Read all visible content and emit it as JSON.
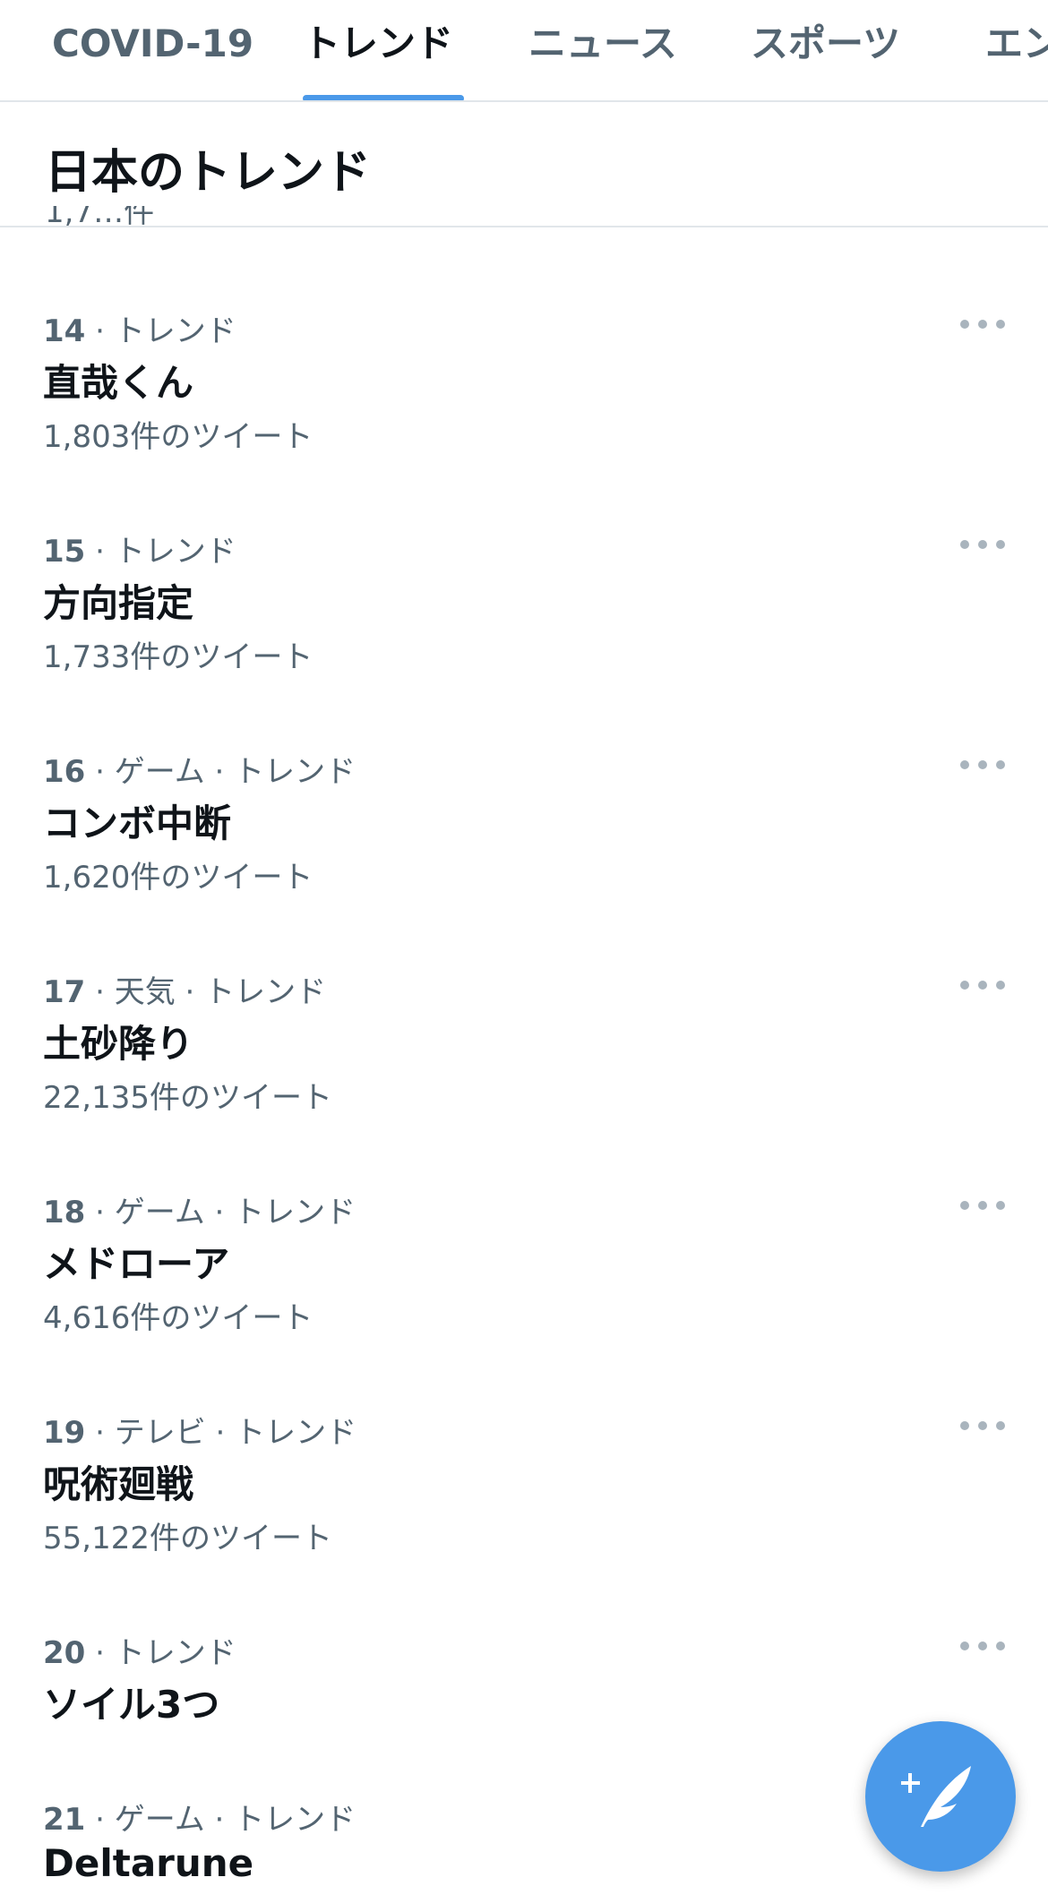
{
  "tabs": [
    {
      "label": "COVID-19",
      "active": false
    },
    {
      "label": "トレンド",
      "active": true
    },
    {
      "label": "ニュース",
      "active": false
    },
    {
      "label": "スポーツ",
      "active": false
    },
    {
      "label": "エンタメ",
      "active": false
    }
  ],
  "section": {
    "title": "日本のトレンド",
    "clipped_text": "1,7…件"
  },
  "trends": [
    {
      "rank": "14",
      "context": " · トレンド",
      "name": "直哉くん",
      "count": "1,803件のツイート"
    },
    {
      "rank": "15",
      "context": " · トレンド",
      "name": "方向指定",
      "count": "1,733件のツイート"
    },
    {
      "rank": "16",
      "context": " · ゲーム · トレンド",
      "name": "コンボ中断",
      "count": "1,620件のツイート"
    },
    {
      "rank": "17",
      "context": " · 天気 · トレンド",
      "name": "土砂降り",
      "count": "22,135件のツイート"
    },
    {
      "rank": "18",
      "context": " · ゲーム · トレンド",
      "name": "メドローア",
      "count": "4,616件のツイート"
    },
    {
      "rank": "19",
      "context": " · テレビ · トレンド",
      "name": "呪術廻戦",
      "count": "55,122件のツイート"
    },
    {
      "rank": "20",
      "context": " · トレンド",
      "name": "ソイル3つ",
      "count": ""
    },
    {
      "rank": "21",
      "context": " · ゲーム · トレンド",
      "name": "Deltarune",
      "count": ""
    }
  ],
  "colors": {
    "accent": "#4a99e9",
    "text_primary": "#0f1419",
    "text_secondary": "#536471",
    "divider": "#e1e6ea"
  },
  "icons": {
    "more": "more-dots-icon",
    "compose": "compose-feather-icon"
  }
}
